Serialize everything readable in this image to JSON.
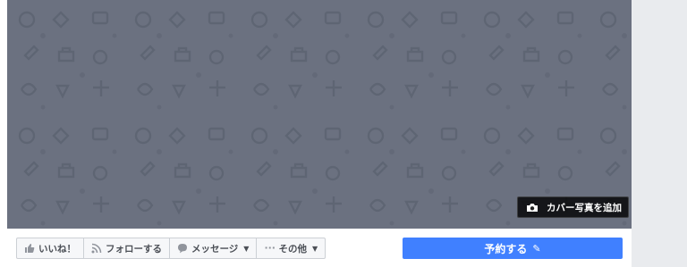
{
  "cover": {
    "add_cover_photo_label": "カバー写真を追加",
    "background_color": "#6b7180",
    "camera_icon": "camera-icon"
  },
  "action_bar": {
    "like_label": "いいね！",
    "follow_label": "フォローする",
    "message_label": "メッセージ",
    "more_label": "その他",
    "reserve_label": "予約する",
    "reserve_color": "#4080ff",
    "icons": {
      "like": "thumbs-up-icon",
      "follow": "rss-icon",
      "message": "speech-bubble-icon",
      "more": "ellipsis-icon",
      "dropdown": "caret-down-icon",
      "edit": "pencil-icon"
    }
  }
}
